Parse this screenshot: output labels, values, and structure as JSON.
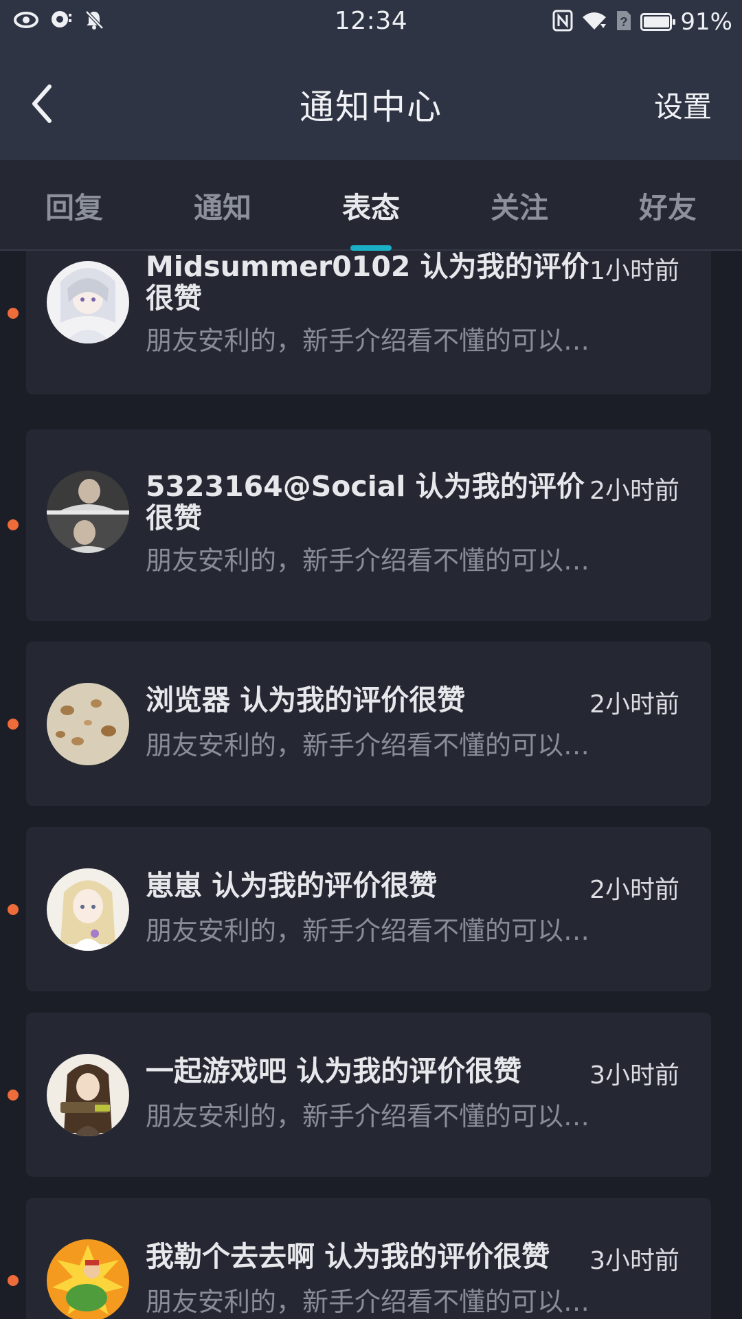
{
  "status_bar": {
    "time": "12:34",
    "battery_percent": "91%",
    "battery_level": 0.91,
    "left_icons": [
      "eye-icon",
      "chat-bubble-icon",
      "bell-off-icon"
    ],
    "right_icons": [
      "nfc-icon",
      "wifi-icon",
      "no-sim-icon",
      "battery-icon"
    ]
  },
  "header": {
    "title": "通知中心",
    "settings_label": "设置",
    "back_icon": "chevron-left-icon"
  },
  "tabs": [
    {
      "label": "回复",
      "active": false
    },
    {
      "label": "通知",
      "active": false
    },
    {
      "label": "表态",
      "active": true
    },
    {
      "label": "关注",
      "active": false
    },
    {
      "label": "好友",
      "active": false
    }
  ],
  "colors": {
    "accent": "#1ab0c5",
    "unread_dot": "#ee6b3a",
    "background": "#1c1e27",
    "card": "#252733",
    "header": "#2f3444"
  },
  "notifications": [
    {
      "title": "Midsummer0102 认为我的评价很赞",
      "time": "1小时前",
      "desc": "朋友安利的，新手介绍看不懂的可以去看论...",
      "unread": true
    },
    {
      "title": "5323164@Social 认为我的评价很赞",
      "time": "2小时前",
      "desc": "朋友安利的，新手介绍看不懂的可以去看论...",
      "unread": true
    },
    {
      "title": "浏览器 认为我的评价很赞",
      "time": "2小时前",
      "desc": "朋友安利的，新手介绍看不懂的可以去看论...",
      "unread": true
    },
    {
      "title": "崽崽 认为我的评价很赞",
      "time": "2小时前",
      "desc": "朋友安利的，新手介绍看不懂的可以去看论...",
      "unread": true
    },
    {
      "title": "一起游戏吧 认为我的评价很赞",
      "time": "3小时前",
      "desc": "朋友安利的，新手介绍看不懂的可以去看论...",
      "unread": true
    },
    {
      "title": "我勒个去去啊 认为我的评价很赞",
      "time": "3小时前",
      "desc": "朋友安利的，新手介绍看不懂的可以去看论...",
      "unread": true
    }
  ]
}
